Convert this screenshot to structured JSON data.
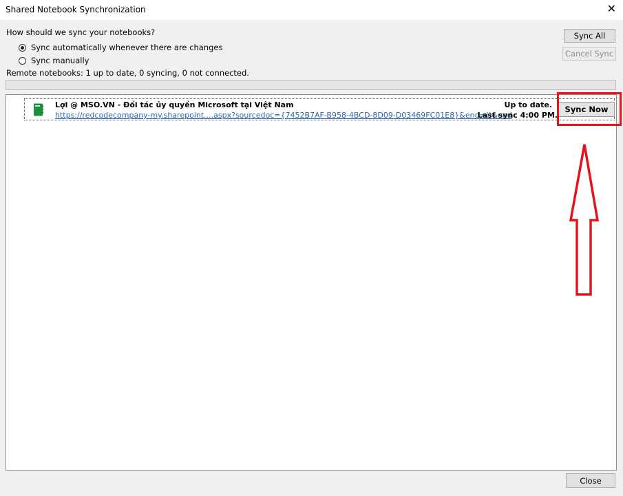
{
  "window": {
    "title": "Shared Notebook Synchronization",
    "close_glyph": "✕"
  },
  "sync_options": {
    "question": "How should we sync your notebooks?",
    "options": [
      {
        "label": "Sync automatically whenever there are changes",
        "selected": true
      },
      {
        "label": "Sync manually",
        "selected": false
      }
    ]
  },
  "buttons": {
    "sync_all": "Sync All",
    "cancel_sync": "Cancel Sync",
    "close": "Close",
    "sync_now": "Sync Now"
  },
  "remote_status": "Remote notebooks: 1 up to date, 0 syncing, 0 not connected.",
  "notebooks": [
    {
      "name": "Lợi @ MSO.VN - Đối tác ủy quyền Microsoft tại Việt Nam",
      "url": "https://redcodecompany-my.sharepoint....aspx?sourcedoc={7452B7AF-B958-4BCD-8D09-D03469FC01E8}&end=()&end",
      "status": "Up to date.",
      "last_sync": "Last sync 4:00 PM.",
      "icon": "onenote-notebook-icon"
    }
  ],
  "colors": {
    "annotation_red": "#e3141c",
    "notebook_green": "#1a8f3c",
    "link_blue": "#2a64b3"
  }
}
